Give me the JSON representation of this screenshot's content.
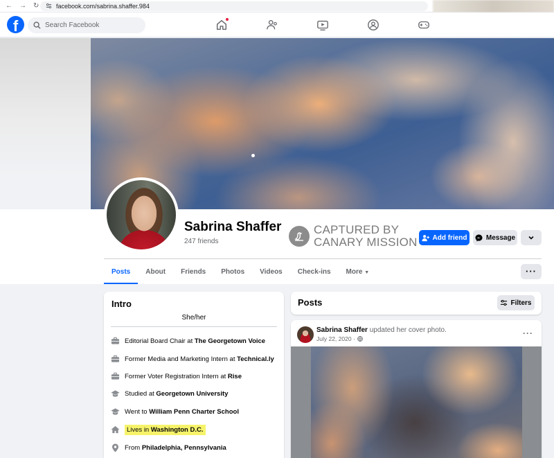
{
  "browser": {
    "url": "facebook.com/sabrina.shaffer.984"
  },
  "topbar": {
    "logo_letter": "f",
    "search_placeholder": "Search Facebook"
  },
  "profile": {
    "name": "Sabrina Shaffer",
    "friends": "247 friends",
    "add_friend_label": "Add friend",
    "message_label": "Message"
  },
  "stamp": {
    "line1": "CAPTURED BY",
    "line2": "CANARY MISSION"
  },
  "tabs": [
    {
      "label": "Posts"
    },
    {
      "label": "About"
    },
    {
      "label": "Friends"
    },
    {
      "label": "Photos"
    },
    {
      "label": "Videos"
    },
    {
      "label": "Check-ins"
    },
    {
      "label": "More"
    }
  ],
  "intro": {
    "title": "Intro",
    "pronouns": "She/her",
    "items": [
      {
        "icon": "briefcase-icon",
        "prefix": "Editorial Board Chair at ",
        "bold": "The Georgetown Voice"
      },
      {
        "icon": "briefcase-icon",
        "prefix": "Former Media and Marketing Intern at ",
        "bold": "Technical.ly"
      },
      {
        "icon": "briefcase-icon",
        "prefix": "Former Voter Registration Intern at ",
        "bold": "Rise"
      },
      {
        "icon": "graduation-cap-icon",
        "prefix": "Studied at ",
        "bold": "Georgetown University"
      },
      {
        "icon": "graduation-cap-icon",
        "prefix": "Went to ",
        "bold": "William Penn Charter School"
      },
      {
        "icon": "home-icon",
        "prefix": "Lives in ",
        "bold": "Washington D.C."
      },
      {
        "icon": "location-pin-icon",
        "prefix": "From ",
        "bold": "Philadelphia, Pennsylvania"
      }
    ]
  },
  "posts": {
    "title": "Posts",
    "filters_label": "Filters",
    "post": {
      "author": "Sabrina Shaffer",
      "action": "updated her cover photo.",
      "date": "July 22, 2020 ·"
    }
  },
  "colors": {
    "brand": "#0866ff",
    "highlight": "#f6f36b",
    "notification": "#e41e3f"
  }
}
